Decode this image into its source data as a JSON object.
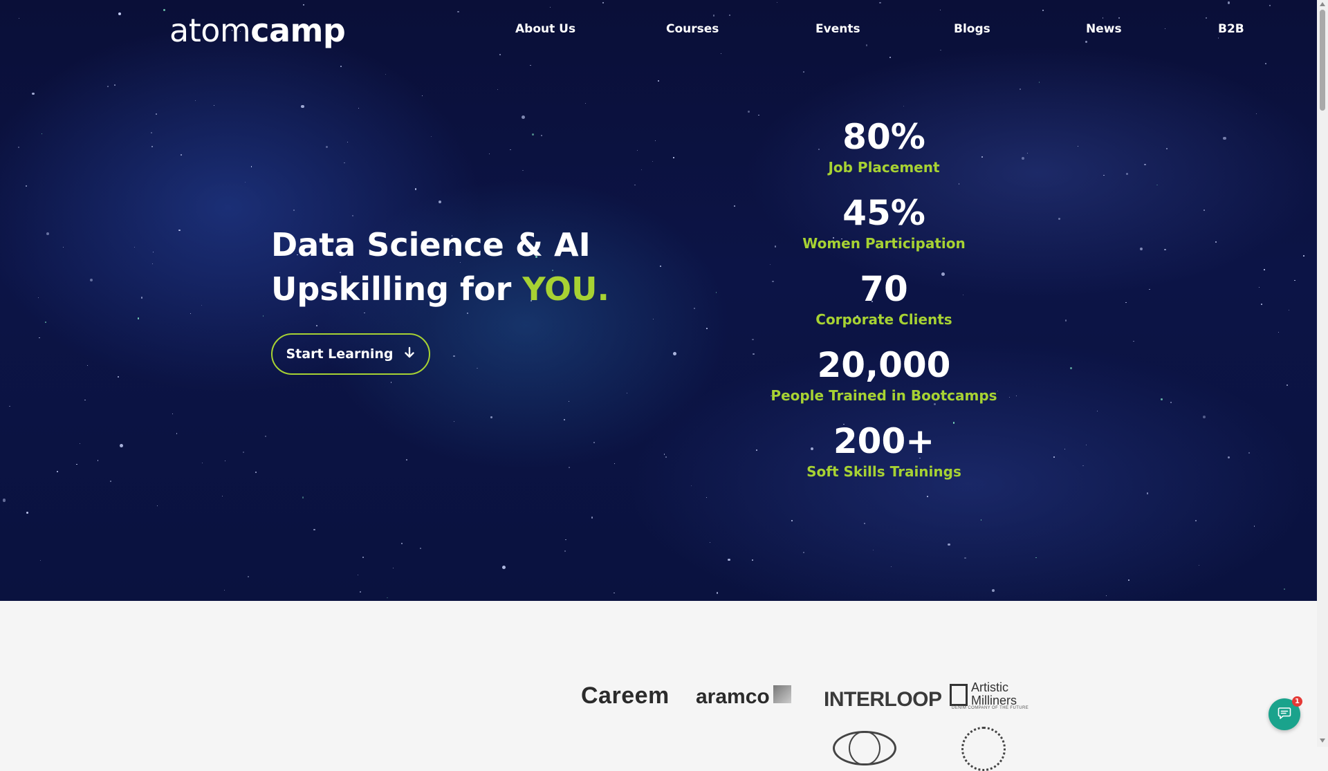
{
  "header": {
    "logo_light": "atom",
    "logo_bold": "camp",
    "nav": [
      {
        "label": "About Us"
      },
      {
        "label": "Courses"
      },
      {
        "label": "Events"
      },
      {
        "label": "Blogs"
      },
      {
        "label": "News"
      },
      {
        "label": "B2B"
      }
    ]
  },
  "hero": {
    "headline_line1": "Data Science & AI",
    "headline_line2_prefix": "Upskilling for ",
    "headline_accent": "YOU.",
    "cta_label": "Start Learning",
    "cta_icon": "arrow-down-icon"
  },
  "stats": [
    {
      "value": "80%",
      "label": "Job Placement"
    },
    {
      "value": "45%",
      "label": "Women Participation"
    },
    {
      "value": "70",
      "label": "Corporate Clients"
    },
    {
      "value": "20,000",
      "label": "People Trained in Bootcamps"
    },
    {
      "value": "200+",
      "label": "Soft Skills Trainings"
    }
  ],
  "clients": {
    "careem": "Careem",
    "aramco": "aramco",
    "interloop": "INTERLOOP",
    "artistic_line1": "Artistic",
    "artistic_line2": "Milliners",
    "artistic_tagline": "DENIM COMPANY OF THE FUTURE"
  },
  "chat": {
    "icon": "chat-bubble-icon",
    "badge": "1"
  },
  "colors": {
    "accent": "#a7d233",
    "hero_bg": "#0b1242",
    "chat": "#1aa38c",
    "badge": "#e53935"
  }
}
